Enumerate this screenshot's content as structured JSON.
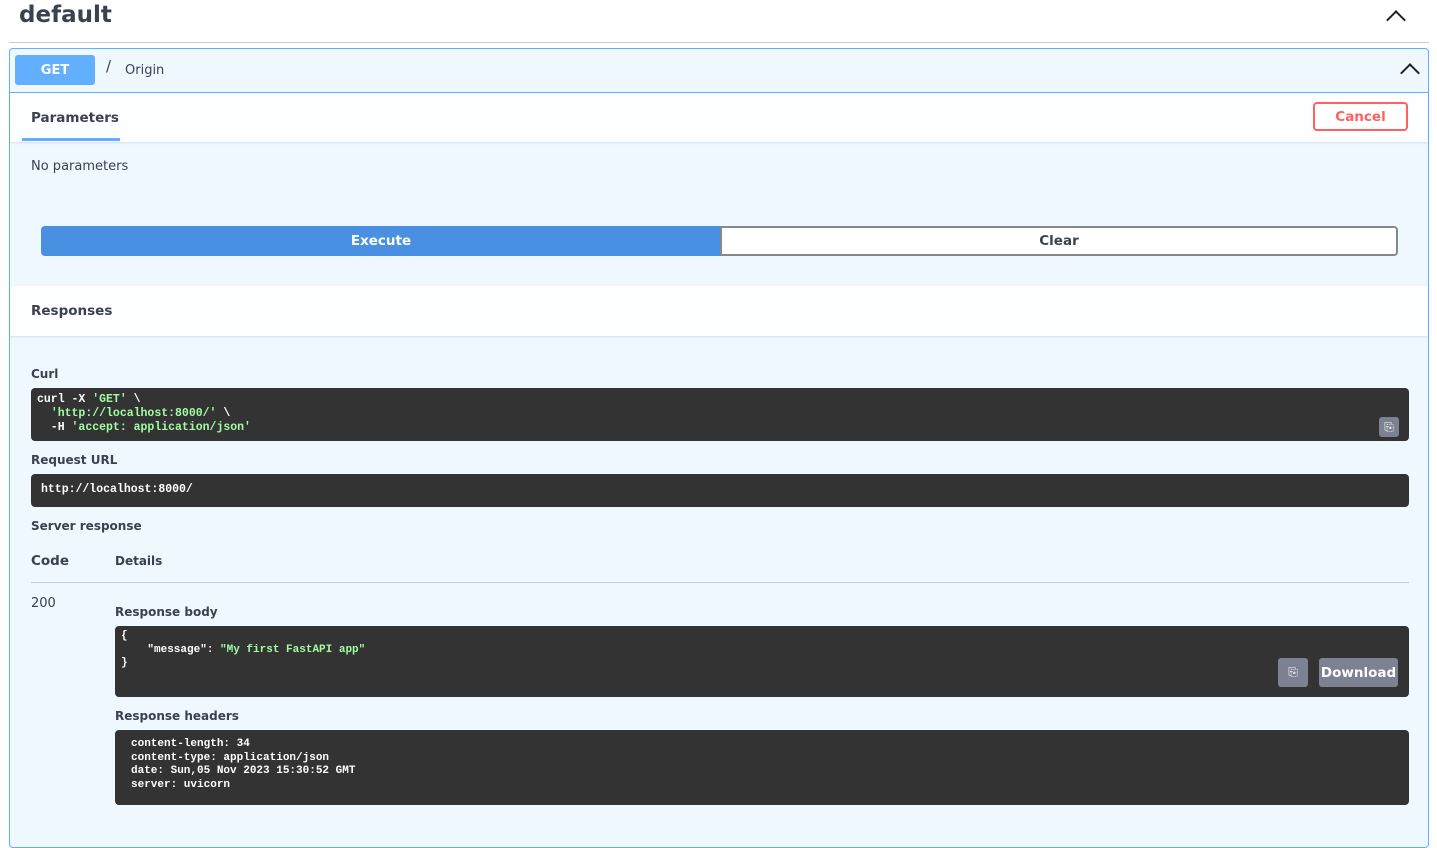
{
  "section": {
    "title": "default"
  },
  "operation": {
    "method": "GET",
    "path": "/",
    "summary": "Origin"
  },
  "parameters": {
    "tab_label": "Parameters",
    "cancel_label": "Cancel",
    "empty_text": "No parameters"
  },
  "actions": {
    "execute_label": "Execute",
    "clear_label": "Clear"
  },
  "responses": {
    "title": "Responses",
    "curl_label": "Curl",
    "curl_lines": [
      "curl -X ",
      "'GET'",
      " \\",
      "  ",
      "'http://localhost:8000/'",
      " \\",
      "  -H ",
      "'accept: application/json'"
    ],
    "request_url_label": "Request URL",
    "request_url": "http://localhost:8000/",
    "server_response_label": "Server response",
    "code_header": "Code",
    "details_header": "Details",
    "code": "200",
    "response_body_label": "Response body",
    "body_lines": [
      "{",
      "  \"message\"",
      ": ",
      "\"My first FastAPI app\"",
      "}"
    ],
    "download_label": "Download",
    "response_headers_label": "Response headers",
    "headers": [
      "content-length: 34",
      "content-type: application/json",
      "date: Sun,05 Nov 2023 15:30:52 GMT",
      "server: uvicorn"
    ]
  }
}
